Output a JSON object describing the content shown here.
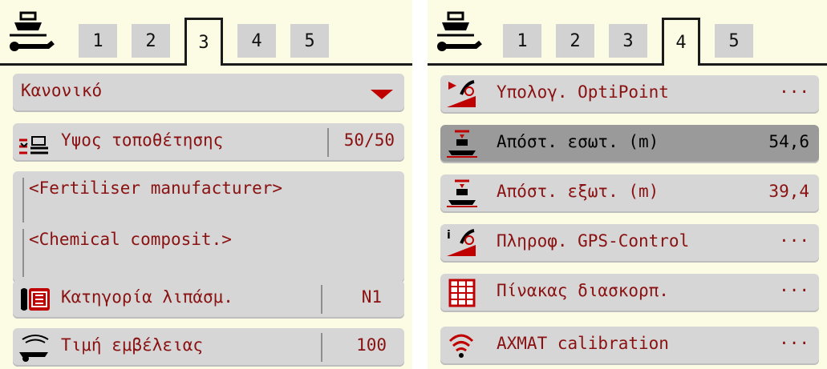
{
  "left": {
    "tabs": [
      "1",
      "2",
      "3",
      "4",
      "5"
    ],
    "active_tab": "3",
    "dropdown": {
      "value": "Κανονικό"
    },
    "rows": {
      "height_label": "Υψος τοποθέτησης",
      "height_value": "50/50",
      "manufacturer": "<Fertiliser manufacturer>",
      "composition": "<Chemical composit.>",
      "category_label": "Κατηγορία λιπάσμ.",
      "category_value": "N1",
      "range_label": "Τιμή εμβέλειας",
      "range_value": "100"
    }
  },
  "right": {
    "tabs": [
      "1",
      "2",
      "3",
      "4",
      "5"
    ],
    "active_tab": "4",
    "rows": {
      "optipoint_label": "Υπολογ. OptiPoint",
      "optipoint_value": "···",
      "inner_label": "Απόστ. εσωτ. (m)",
      "inner_value": "54,6",
      "outer_label": "Απόστ. εξωτ. (m)",
      "outer_value": "39,4",
      "gps_label": "Πληροφ. GPS-Control",
      "gps_value": "···",
      "table_label": "Πίνακας διασκορπ.",
      "table_value": "···",
      "axmat_label": "AXMAT calibration",
      "axmat_value": "···"
    }
  },
  "colors": {
    "background": "#fcfbe3",
    "row": "#d6d6d6",
    "row_selected": "#9a9a9a",
    "text": "#8a1111",
    "accent": "#c00000"
  },
  "icons": [
    "machine-settings-icon",
    "height-icon",
    "fertiliser-category-icon",
    "throwing-range-icon",
    "optipoint-icon",
    "inner-distance-icon",
    "outer-distance-icon",
    "gps-control-icon",
    "spreading-chart-icon",
    "axmat-icon"
  ]
}
